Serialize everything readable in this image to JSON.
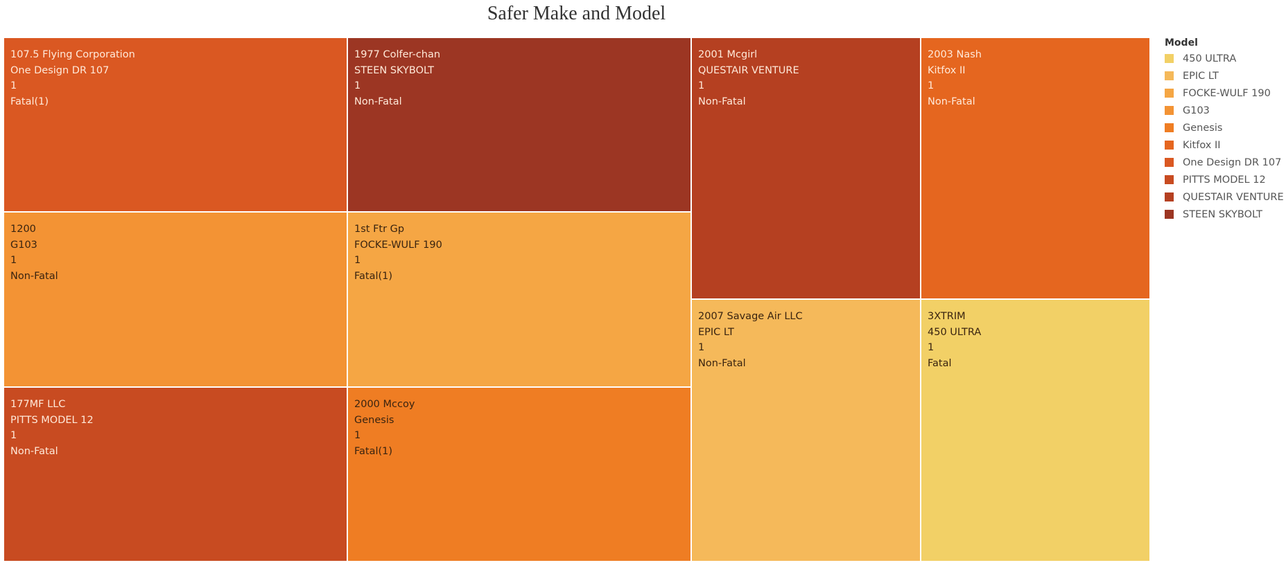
{
  "chart_data": {
    "type": "treemap",
    "title": "Safer Make and Model",
    "legend": {
      "title": "Model",
      "placement": "right",
      "items": [
        {
          "label": "450 ULTRA",
          "color": "#f2d066"
        },
        {
          "label": "EPIC LT",
          "color": "#f5b95a"
        },
        {
          "label": "FOCKE-WULF 190",
          "color": "#f5a644"
        },
        {
          "label": "G103",
          "color": "#f39334"
        },
        {
          "label": "Genesis",
          "color": "#ef7d23"
        },
        {
          "label": "Kitfox II",
          "color": "#e5661f"
        },
        {
          "label": "One Design DR 107",
          "color": "#da5822"
        },
        {
          "label": "PITTS MODEL 12",
          "color": "#c84b21"
        },
        {
          "label": "QUESTAIR VENTURE",
          "color": "#b54021"
        },
        {
          "label": "STEEN SKYBOLT",
          "color": "#9c3623"
        }
      ]
    },
    "tiles": [
      {
        "make": "107.5 Flying Corporation",
        "model": "One Design DR 107",
        "count": "1",
        "severity": "Fatal(1)",
        "color": "#da5822",
        "text_color": "#ffe9d9"
      },
      {
        "make": "1977 Colfer-chan",
        "model": "STEEN SKYBOLT",
        "count": "1",
        "severity": "Non-Fatal",
        "color": "#9c3623",
        "text_color": "#ffe9d9"
      },
      {
        "make": "2001 Mcgirl",
        "model": "QUESTAIR VENTURE",
        "count": "1",
        "severity": "Non-Fatal",
        "color": "#b54021",
        "text_color": "#ffe9d9"
      },
      {
        "make": "2003 Nash",
        "model": "Kitfox II",
        "count": "1",
        "severity": "Non-Fatal",
        "color": "#e5661f",
        "text_color": "#ffe9d9"
      },
      {
        "make": "1200",
        "model": "G103",
        "count": "1",
        "severity": "Non-Fatal",
        "color": "#f39334",
        "text_color": "#3a2410"
      },
      {
        "make": "1st Ftr Gp",
        "model": "FOCKE-WULF 190",
        "count": "1",
        "severity": "Fatal(1)",
        "color": "#f5a644",
        "text_color": "#3a2410"
      },
      {
        "make": "2007 Savage Air LLC",
        "model": "EPIC LT",
        "count": "1",
        "severity": "Non-Fatal",
        "color": "#f5b95a",
        "text_color": "#3a2410"
      },
      {
        "make": "3XTRIM",
        "model": "450 ULTRA",
        "count": "1",
        "severity": "Fatal",
        "color": "#f2d066",
        "text_color": "#3a2410"
      },
      {
        "make": "177MF LLC",
        "model": "PITTS MODEL 12",
        "count": "1",
        "severity": "Non-Fatal",
        "color": "#c84b21",
        "text_color": "#ffe9d9"
      },
      {
        "make": "2000 Mccoy",
        "model": "Genesis",
        "count": "1",
        "severity": "Fatal(1)",
        "color": "#ef7d23",
        "text_color": "#3a2410"
      }
    ]
  }
}
